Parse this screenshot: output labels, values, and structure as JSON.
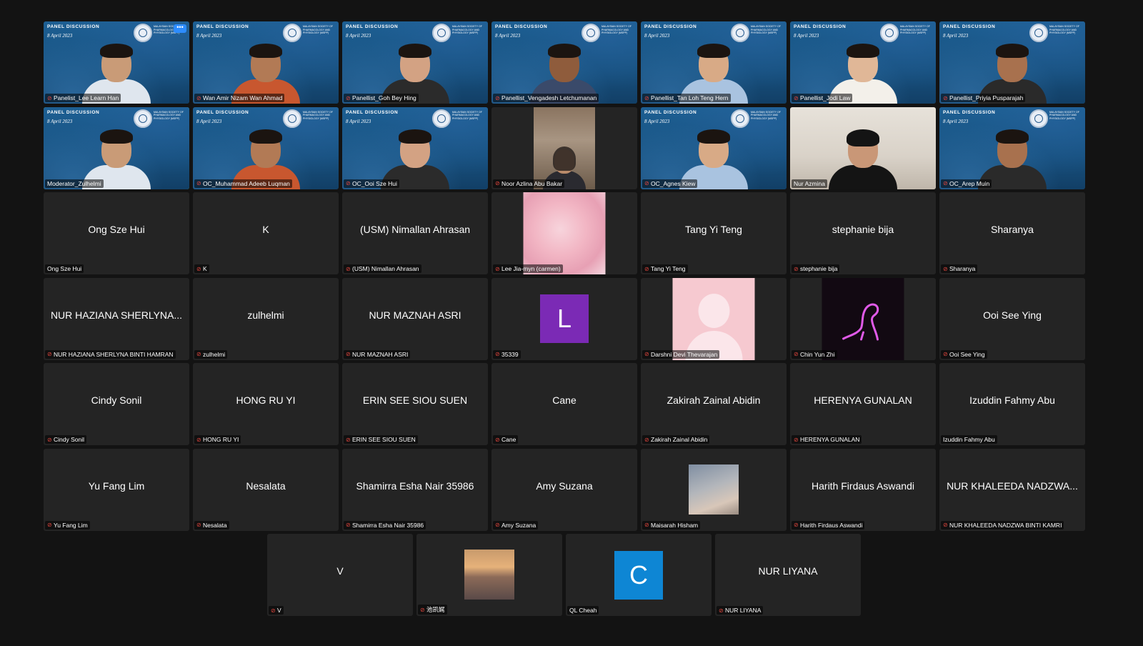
{
  "colors": {
    "background": "#131313",
    "tile": "#242424",
    "active_speaker_border": "#4ad96a",
    "muted_mic": "#e0453d",
    "avatar_L": "#7b2ab5",
    "avatar_C": "#0e86d4"
  },
  "banner": {
    "title": "PANEL DISCUSSION",
    "date": "8 April 2023",
    "society": "MALAYSIAN SOCIETY OF PHARMACOLOGY AND PHYSIOLOGY (MSPP)"
  },
  "participants": [
    {
      "label": "Panelist_Lee Learn Han",
      "type": "video",
      "muted": true,
      "more_menu": "•••"
    },
    {
      "label": "Wan Amir Nizam Wan Ahmad",
      "type": "video",
      "muted": true
    },
    {
      "label": "Panellist_Goh Bey Hing",
      "type": "video",
      "muted": true
    },
    {
      "label": "Panellist_Vengadesh Letchumanan",
      "type": "video",
      "muted": true
    },
    {
      "label": "Panellist_Tan Loh Teng Hern",
      "type": "video",
      "muted": true
    },
    {
      "label": "Panellist_Jodi Law",
      "type": "video",
      "muted": true
    },
    {
      "label": "Panellist_Priyia Pusparajah",
      "type": "video",
      "muted": true
    },
    {
      "label": "Moderator_Zulhelmi",
      "type": "video",
      "muted": false,
      "active": true
    },
    {
      "label": "OC_Muhammad Adeeb Luqman",
      "type": "video",
      "muted": true
    },
    {
      "label": "OC_Ooi Sze Hui",
      "type": "video",
      "muted": true
    },
    {
      "label": "Noor Azlina Abu Bakar",
      "type": "webcam",
      "muted": true
    },
    {
      "label": "OC_Agnes Kiew",
      "type": "video",
      "muted": true
    },
    {
      "label": "Nur Azmina",
      "type": "webcam-wide",
      "muted": false
    },
    {
      "label": "OC_Arep Muin",
      "type": "video",
      "muted": true
    },
    {
      "label": "Ong Sze Hui",
      "name": "Ong Sze Hui",
      "type": "name",
      "muted": false
    },
    {
      "label": "K",
      "name": "K",
      "type": "name",
      "muted": true
    },
    {
      "label": "(USM) Nimallan Ahrasan",
      "name": "(USM) Nimallan Ahrasan",
      "type": "name",
      "muted": true
    },
    {
      "label": "Lee Jia-myn (carmen)",
      "type": "pic-pink",
      "muted": true
    },
    {
      "label": "Tang Yi Teng",
      "name": "Tang Yi Teng",
      "type": "name",
      "muted": true
    },
    {
      "label": "stephanie bija",
      "name": "stephanie bija",
      "type": "name",
      "muted": true
    },
    {
      "label": "Sharanya",
      "name": "Sharanya",
      "type": "name",
      "muted": true
    },
    {
      "label": "NUR HAZIANA SHERLYNA BINTI HAMRAN",
      "name": "NUR HAZIANA SHERLYNA...",
      "type": "name",
      "muted": true
    },
    {
      "label": "zulhelmi",
      "name": "zulhelmi",
      "type": "name",
      "muted": true
    },
    {
      "label": "NUR MAZNAH ASRI",
      "name": "NUR MAZNAH ASRI",
      "type": "name",
      "muted": true
    },
    {
      "label": "35339",
      "initial": "L",
      "type": "initial-L",
      "muted": true
    },
    {
      "label": "Darshni Devi Thevarajan",
      "type": "pic-default",
      "muted": true
    },
    {
      "label": "Chin Yun Zhi",
      "type": "pic-neon",
      "muted": true
    },
    {
      "label": "Ooi See Ying",
      "name": "Ooi See Ying",
      "type": "name",
      "muted": true
    },
    {
      "label": "Cindy Sonil",
      "name": "Cindy Sonil",
      "type": "name",
      "muted": true
    },
    {
      "label": "HONG RU YI",
      "name": "HONG RU YI",
      "type": "name",
      "muted": true
    },
    {
      "label": "ERIN SEE SIOU SUEN",
      "name": "ERIN SEE SIOU SUEN",
      "type": "name",
      "muted": true
    },
    {
      "label": "Cane",
      "name": "Cane",
      "type": "name",
      "muted": true
    },
    {
      "label": "Zakirah Zainal Abidin",
      "name": "Zakirah Zainal Abidin",
      "type": "name",
      "muted": true
    },
    {
      "label": "HERENYA GUNALAN",
      "name": "HERENYA GUNALAN",
      "type": "name",
      "muted": true
    },
    {
      "label": "Izuddin Fahmy Abu",
      "name": "Izuddin Fahmy Abu",
      "type": "name",
      "muted": false
    },
    {
      "label": "Yu Fang Lim",
      "name": "Yu Fang Lim",
      "type": "name",
      "muted": true
    },
    {
      "label": "Nesalata",
      "name": "Nesalata",
      "type": "name",
      "muted": true
    },
    {
      "label": "Shamirra Esha Nair 35986",
      "name": "Shamirra Esha Nair 35986",
      "type": "name",
      "muted": true
    },
    {
      "label": "Amy Suzana",
      "name": "Amy Suzana",
      "type": "name",
      "muted": true
    },
    {
      "label": "Maisarah Hisham",
      "type": "pic-sky",
      "muted": true
    },
    {
      "label": "Harith Firdaus Aswandi",
      "name": "Harith Firdaus Aswandi",
      "type": "name",
      "muted": true
    },
    {
      "label": "NUR KHALEEDA NADZWA BINTI KAMRI",
      "name": "NUR KHALEEDA NADZWA...",
      "type": "name",
      "muted": true
    },
    {
      "label": "V",
      "name": "V",
      "type": "name",
      "muted": true
    },
    {
      "label": "池凯娓",
      "type": "pic-sunset",
      "muted": true
    },
    {
      "label": "QL Cheah",
      "initial": "C",
      "type": "initial-C",
      "muted": false
    },
    {
      "label": "NUR LIYANA",
      "name": "NUR LIYANA",
      "type": "name",
      "muted": true
    }
  ]
}
